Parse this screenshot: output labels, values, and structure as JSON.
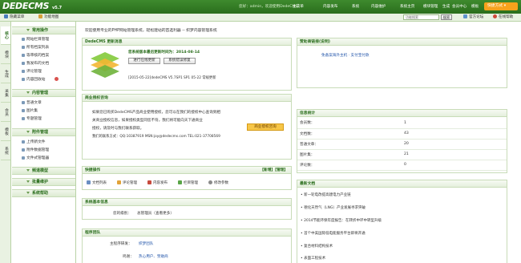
{
  "header": {
    "logo": "DEDECMS",
    "version": "v5.7",
    "welcome": "您好：admin，欢迎使用DedeCMS!",
    "nav": [
      "主菜单",
      "内容发布",
      "系统",
      "内容维护",
      "系统主页",
      "模块管理",
      "生成",
      "会员中心",
      "模板"
    ],
    "quick_menu": "快捷方式"
  },
  "subbar": {
    "hide_menu": "隐藏菜单",
    "function_map": "功能地图",
    "search_placeholder": "功能搜索",
    "search_button": "搜索",
    "forum": "官方论坛",
    "online_help": "在线帮助"
  },
  "lefttabs": [
    "核心",
    "模块",
    "生成",
    "采集",
    "会员",
    "模板",
    "系统"
  ],
  "leftmenu": {
    "groups": [
      {
        "title": "常用操作",
        "items": [
          "网站栏目管理",
          "所有档案列表",
          "等审核的档案",
          "我发布的文档",
          "评论管理",
          "内容回收站"
        ]
      },
      {
        "title": "内容管理",
        "items": [
          "普通文章",
          "图片集",
          "专题管理"
        ]
      },
      {
        "title": "附件管理",
        "items": [
          "上传新文件",
          "附件数据管理",
          "文件式管理器"
        ]
      },
      {
        "title": "频道模型",
        "items": []
      },
      {
        "title": "批量维护",
        "items": []
      },
      {
        "title": "系统帮助",
        "items": []
      }
    ]
  },
  "content": {
    "notice": "欢迎使用专业的PHP网站管理系统，轻松建站的首选利器 -- 织梦内容管理系统",
    "update_panel": {
      "title": "DedeCMS 更新消息",
      "version_line": "您系统版本最后更新时间为：2014-08-14",
      "btn_check": "进行在线更新",
      "btn_status": "系统错误修复",
      "log": "[2015-05-22]dedeCMS V5.7SP1 SP1 05-22 常规更新"
    },
    "license_panel": {
      "title": "商业授权咨询",
      "lines": [
        "如果您已购买DedeCMS产品商业使用授权，您可以在我们的授权中心查询到相",
        "关商业授权信息，如果授权类型同您不符，我们将可能向天下通商业",
        "授权，请及时与我们联系获取。",
        "我们的联系方式：QQ:10387919 MSN:joy@dedecms.com TEL:021-37708569"
      ],
      "button": "商业授权咨询"
    },
    "quick_panel": {
      "title": "快捷操作",
      "extra": "【新增】【管理】",
      "items": [
        "文档列表",
        "评论管理",
        "内容发布",
        "栏目管理",
        "修改参数"
      ]
    },
    "sysinfo_panel": {
      "title": "系统基本信息",
      "label": "您的级别：",
      "value": "总管理员（查看更多）"
    },
    "team_panel": {
      "title": "程序团队",
      "rows": [
        {
          "label": "主程序研发：",
          "value": "织梦团队"
        },
        {
          "label": "鸣谢：",
          "value": "热心用户、赞助商"
        }
      ]
    },
    "sponsor_panel": {
      "title": "赞助商链接(说明)",
      "text": "免备案海外主机 · 支付宝付款"
    },
    "stats_panel": {
      "title": "信息统计",
      "rows": [
        {
          "label": "会员数：",
          "value": "1"
        },
        {
          "label": "文档数：",
          "value": "43"
        },
        {
          "label": "普通文章：",
          "value": "20"
        },
        {
          "label": "图片集：",
          "value": "21"
        },
        {
          "label": "评论数：",
          "value": "0"
        }
      ]
    },
    "news_panel": {
      "title": "最新文档",
      "items": [
        "新一轮电改提高建电力产业链",
        "德化天然气（LNG）产业发展寻求突破",
        "2014节能环保年度报告：在转折中环中转型升级",
        "首个中美国际低电能服务平台即将开通",
        "复合材料结构技术",
        "表面工程技术"
      ]
    }
  }
}
